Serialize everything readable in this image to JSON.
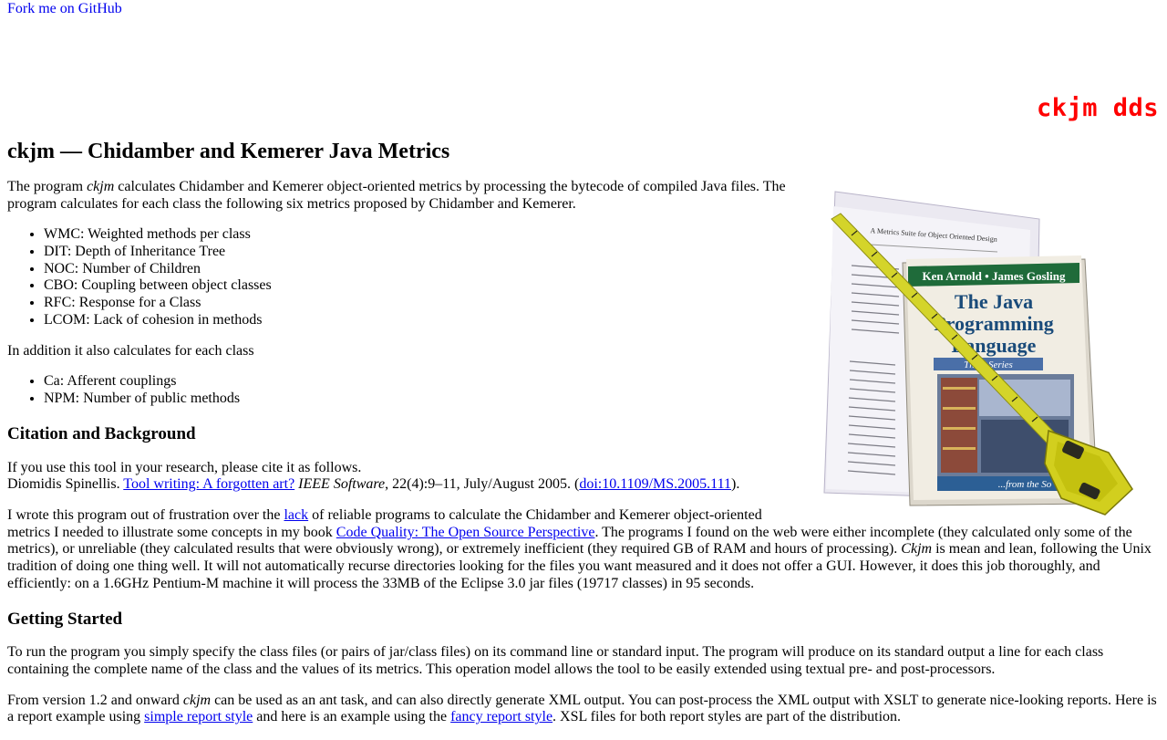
{
  "fork_link": {
    "alt": "Fork me on GitHub"
  },
  "brand": {
    "text": "ckjm dds"
  },
  "title": "ckjm — Chidamber and Kemerer Java Metrics",
  "photo": {
    "paper_title": "A Metrics Suite for Object Oriented Design",
    "book_authors": "Ken Arnold • James Gosling",
    "book_title_line1": "The Java",
    "book_title_line2": "Programming",
    "book_title_line3": "Language",
    "book_series": "Third Series",
    "book_footer": "...from the So"
  },
  "intro": {
    "before_em": "The program ",
    "em": "ckjm",
    "after_em": " calculates Chidamber and Kemerer object-oriented metrics by processing the bytecode of compiled Java files. The program calculates for each class the following six metrics proposed by Chidamber and Kemerer."
  },
  "ck_metrics": [
    "WMC: Weighted methods per class",
    "DIT: Depth of Inheritance Tree",
    "NOC: Number of Children",
    "CBO: Coupling between object classes",
    "RFC: Response for a Class",
    "LCOM: Lack of cohesion in methods"
  ],
  "additional_intro": "In addition it also calculates for each class",
  "extra_metrics": [
    "Ca: Afferent couplings",
    "NPM: Number of public methods"
  ],
  "citation": {
    "heading": "Citation and Background",
    "line1": "If you use this tool in your research, please cite it as follows.",
    "author": "Diomidis Spinellis. ",
    "paper_link": "Tool writing: A forgotten art?",
    "journal": "IEEE Software",
    "details": ", 22(4):9–11, July/August 2005. (",
    "doi_link": "doi:10.1109/MS.2005.111",
    "close": ")."
  },
  "background": {
    "part1": "I wrote this program out of frustration over the ",
    "lack_link": "lack",
    "part2": " of reliable programs to calculate the Chidamber and Kemerer object-oriented metrics I needed to illustrate some concepts in my book ",
    "book_link": "Code Quality: The Open Source Perspective",
    "part3": ". The programs I found on the web were either incomplete (they calculated only some of the metrics), or unreliable (they calculated results that were obviously wrong), or extremely inefficient (they required GB of RAM and hours of processing). ",
    "em": "Ckjm",
    "part4": " is mean and lean, following the Unix tradition of doing one thing well. It will not automatically recurse directories looking for the files you want measured and it does not offer a GUI. However, it does this job thoroughly, and efficiently: on a 1.6GHz Pentium-M machine it will process the 33MB of the Eclipse 3.0 jar files (19717 classes) in 95 seconds."
  },
  "getting_started": {
    "heading": "Getting Started",
    "para1": "To run the program you simply specify the class files (or pairs of jar/class files) on its command line or standard input. The program will produce on its standard output a line for each class containing the complete name of the class and the values of its metrics. This operation model allows the tool to be easily extended using textual pre- and post-processors.",
    "p2_part1": "From version 1.2 and onward ",
    "p2_em": "ckjm",
    "p2_part2": " can be used as an ant task, and can also directly generate XML output. You can post-process the XML output with XSLT to generate nice-looking reports. Here is a report example using ",
    "simple_link": "simple report style",
    "p2_part3": " and here is an example using the ",
    "fancy_link": "fancy report style",
    "p2_part4": ". XSL files for both report styles are part of the distribution."
  },
  "colors": {
    "brand": "#ff0000",
    "link": "#0000ee",
    "tape_yellow": "#d4d42a",
    "book_green": "#1f6b3a"
  }
}
